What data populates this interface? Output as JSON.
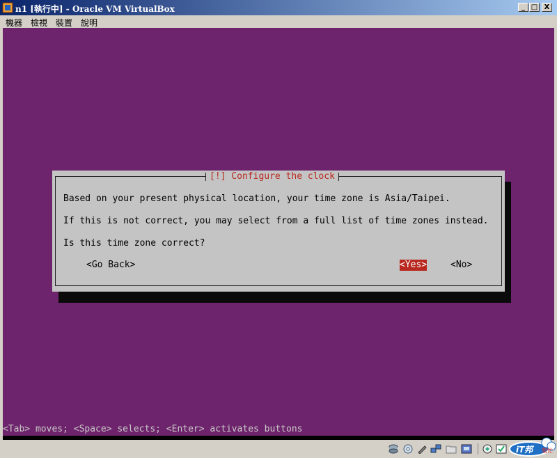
{
  "window": {
    "title": "n1 [執行中] - Oracle VM VirtualBox",
    "controls": {
      "minimize": "_",
      "maximize": "□",
      "close": "X"
    }
  },
  "menu": {
    "items": [
      {
        "label": "機器"
      },
      {
        "label": "檢視"
      },
      {
        "label": "裝置"
      },
      {
        "label": "說明"
      }
    ]
  },
  "dialog": {
    "title": "[!] Configure the clock",
    "lines": [
      "Based on your present physical location, your time zone is Asia/Taipei.",
      "If this is not correct, you may select from a full list of time zones instead.",
      "Is this time zone correct?"
    ],
    "buttons": {
      "go_back": "<Go Back>",
      "yes": "<Yes>",
      "no": "<No>"
    },
    "selected_button": "yes"
  },
  "hint": "<Tab> moves; <Space> selects; <Enter> activates buttons",
  "status_icons": [
    "hard-disk-icon",
    "cd-rom-icon",
    "usb-icon",
    "network-icon",
    "shared-folder-icon",
    "display-icon",
    "virtualization-icon",
    "host-key-icon"
  ],
  "watermark": "iT邦幫忙",
  "colors": {
    "vm_background": "#6e246c",
    "dialog_background": "#c4c4c4",
    "accent_red": "#b8281f",
    "titlebar_start": "#0a246a",
    "titlebar_end": "#a6caf0"
  }
}
